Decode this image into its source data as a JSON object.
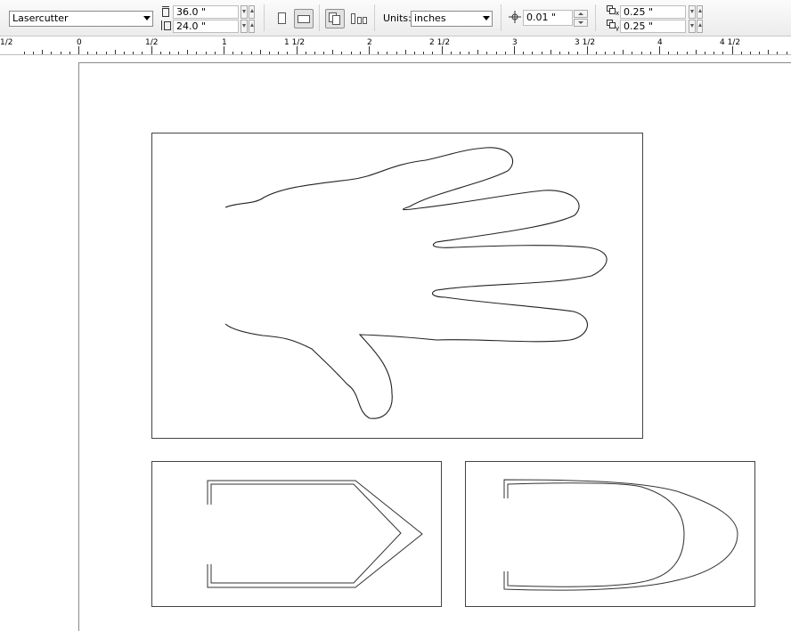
{
  "property_bar": {
    "preset": "Lasercutter",
    "page_width": "36.0 \"",
    "page_height": "24.0 \"",
    "units_label": "Units:",
    "units_value": "inches",
    "nudge": "0.01 \"",
    "duplicate_x": "0.25 \"",
    "duplicate_y": "0.25 \""
  },
  "ruler": {
    "labels": [
      "1/2",
      "0",
      "1/2",
      "1",
      "1 1/2",
      "2",
      "2 1/2",
      "3",
      "3 1/2",
      "4",
      "4 1/2"
    ]
  },
  "icons": {
    "page_width": "page-width-icon",
    "page_height": "page-height-icon",
    "portrait": "portrait-icon",
    "landscape": "landscape-icon",
    "all_pages": "all-pages-icon",
    "current_page": "current-page-icon",
    "nudge": "nudge-icon",
    "duplicate_x": "duplicate-x-icon",
    "duplicate_y": "duplicate-y-icon"
  }
}
